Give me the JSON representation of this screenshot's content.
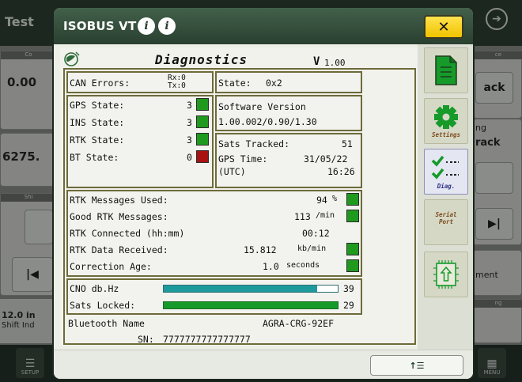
{
  "background": {
    "app_title": "Test",
    "card_header_1": "Co",
    "value_1": "0.00",
    "value_2": "6275.",
    "card_header_2": "Shi",
    "info_value": "12.0 in",
    "info_label": "Shift Ind",
    "right_header": "ce",
    "right_btn_1": "ack",
    "right_text_ng": "ng",
    "right_text_rack": "rack",
    "right_text_ment": "ment",
    "right_header_2": "ng",
    "setup_label": "SETUP",
    "menu_label": "MENU",
    "forward_icon": "arrow-right-circle-icon"
  },
  "dialog": {
    "title": "ISOBUS VT",
    "info_icon_1": "i",
    "info_icon_2": "i",
    "close_label": "✕"
  },
  "diagnostics": {
    "title": "Diagnostics",
    "version_prefix": "V",
    "version_number": "1.00",
    "can_errors_label": "CAN Errors:",
    "can_rx": "Rx:0",
    "can_tx": "Tx:0",
    "state_label": "State:",
    "state_value": "0x2",
    "gps_state_label": "GPS State:",
    "gps_state_value": "3",
    "ins_state_label": "INS State:",
    "ins_state_value": "3",
    "rtk_state_label": "RTK State:",
    "rtk_state_value": "3",
    "bt_state_label": "BT State:",
    "bt_state_value": "0",
    "software_version_label": "Software Version",
    "software_version_value": "1.00.002/0.90/1.30",
    "sats_tracked_label": "Sats Tracked:",
    "sats_tracked_value": "51",
    "gps_time_label": "GPS Time:",
    "gps_time_date": "31/05/22",
    "gps_time_zone": "(UTC)",
    "gps_time_clock": "16:26",
    "rtk_used_label": "RTK Messages Used:",
    "rtk_used_value": "94",
    "rtk_used_unit": "%",
    "good_rtk_label": "Good RTK Messages:",
    "good_rtk_value": "113",
    "good_rtk_unit": "/min",
    "rtk_connected_label": "RTK Connected (hh:mm)",
    "rtk_connected_value": "00:12",
    "rtk_received_label": "RTK Data Received:",
    "rtk_received_value": "15.812",
    "rtk_received_unit": "kb/min",
    "correction_age_label": "Correction Age:",
    "correction_age_value": "1.0",
    "correction_age_unit": "seconds",
    "cno_label": "CNO db.Hz",
    "cno_value": "39",
    "cno_fraction": 0.88,
    "sats_locked_label": "Sats Locked:",
    "sats_locked_value": "29",
    "sats_locked_fraction": 1.0,
    "bluetooth_label": "Bluetooth Name",
    "bluetooth_value": "AGRA-CRG-92EF",
    "sn_label": "SN:",
    "sn_value": "7777777777777777"
  },
  "softkeys": [
    {
      "label": "",
      "icon": "document-icon"
    },
    {
      "label": "Settings",
      "icon": "gear-icon"
    },
    {
      "label": "Diag.",
      "icon": "checklist-icon"
    },
    {
      "label": "Serial\nPort",
      "icon": ""
    },
    {
      "label": "",
      "icon": "chip-upload-icon"
    }
  ],
  "footer": {
    "button_label": "↑☰"
  },
  "colors": {
    "ok": "#1f9a1f",
    "error": "#a81212",
    "cno_bar": "#1d9a9c",
    "sats_bar": "#169a2a",
    "accent_yellow": "#f1c400",
    "header_green": "#2f4434"
  }
}
